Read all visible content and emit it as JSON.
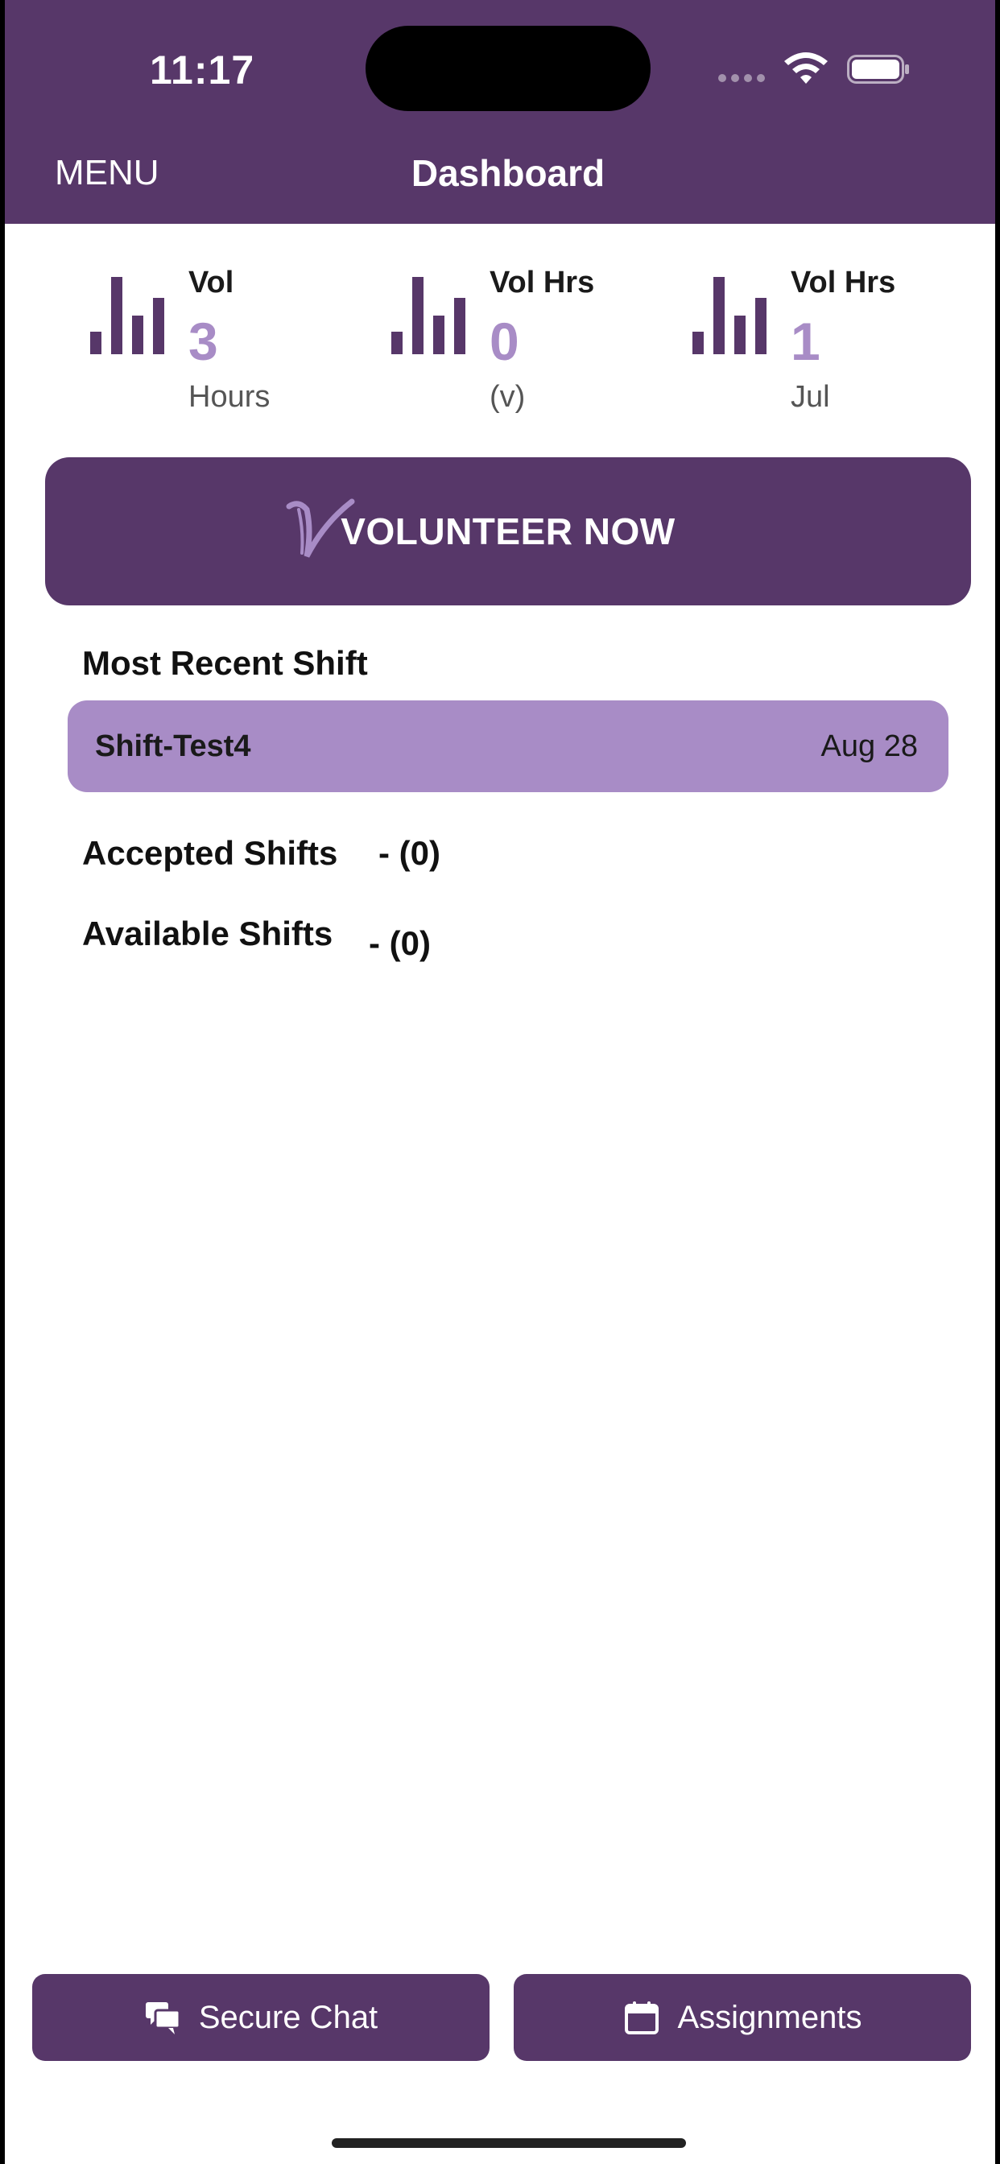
{
  "status_bar": {
    "time": "11:17"
  },
  "nav": {
    "menu_label": "MENU",
    "title": "Dashboard"
  },
  "stats": [
    {
      "label": "Vol",
      "value": "3",
      "unit": "Hours"
    },
    {
      "label": "Vol Hrs",
      "value": "0",
      "unit": "(v)"
    },
    {
      "label": "Vol Hrs",
      "value": "1",
      "unit": "Jul"
    }
  ],
  "volunteer_button": {
    "label": "VOLUNTEER NOW"
  },
  "recent_shift": {
    "title": "Most Recent Shift",
    "name": "Shift-Test4",
    "date": "Aug 28"
  },
  "accepted_shifts": {
    "title": "Accepted Shifts",
    "count": "- (0)"
  },
  "available_shifts": {
    "title": "Available Shifts",
    "count": "- (0)"
  },
  "bottom_bar": {
    "secure_chat_label": "Secure Chat",
    "assignments_label": "Assignments"
  },
  "colors": {
    "brand_purple": "#573769",
    "accent_lavender": "#a88cc6"
  },
  "icons": {
    "stats": "bar-chart-icon",
    "chat": "chat-bubbles-icon",
    "assignments": "calendar-icon"
  }
}
